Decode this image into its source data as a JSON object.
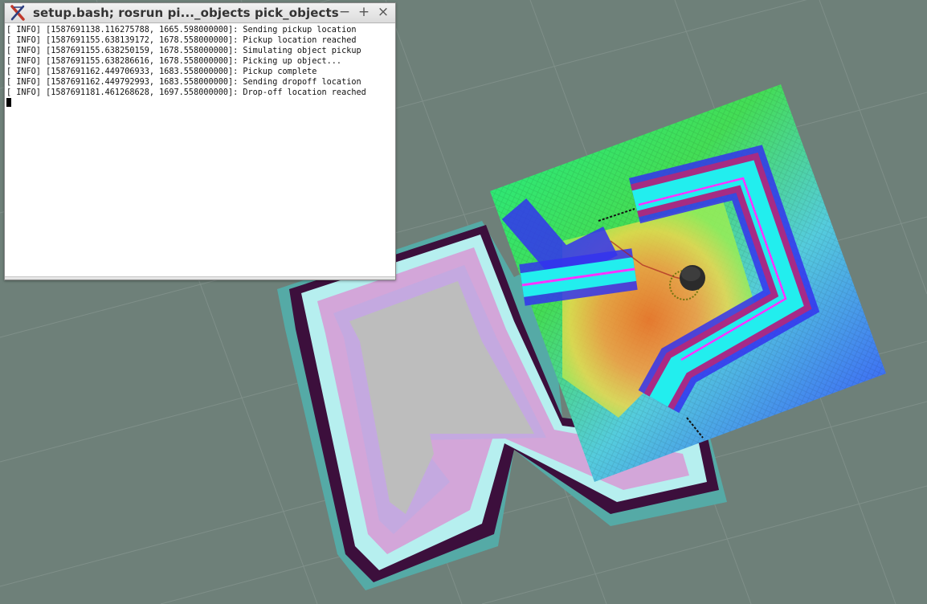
{
  "terminal": {
    "title": "setup.bash; rosrun pi..._objects pick_objects",
    "lines": [
      "[ INFO] [1587691138.116275788, 1665.598000000]: Sending pickup location",
      "[ INFO] [1587691155.638139172, 1678.558000000]: Pickup location reached",
      "[ INFO] [1587691155.638250159, 1678.558000000]: Simulating object pickup",
      "[ INFO] [1587691155.638286616, 1678.558000000]: Picking up object...",
      "[ INFO] [1587691162.449706933, 1683.558000000]: Pickup complete",
      "[ INFO] [1587691162.449792993, 1683.558000000]: Sending dropoff location",
      "[ INFO] [1587691181.461268628, 1697.558000000]: Drop-off location reached"
    ],
    "buttons": {
      "minimize": "−",
      "maximize": "+",
      "close": "×"
    },
    "icon": "xterm-x-icon"
  },
  "viewport": {
    "background_color": "#6e8079",
    "costmap_colors": [
      "#00ff66",
      "#ffcc33",
      "#ff5522",
      "#cc2266",
      "#3333ff",
      "#22eeee",
      "#ff33ff"
    ],
    "map_colors": {
      "free": "#bdbdbd",
      "inflation": "#d3a6d9",
      "wall": "#3c0f3c",
      "border": "#b6efef"
    }
  }
}
